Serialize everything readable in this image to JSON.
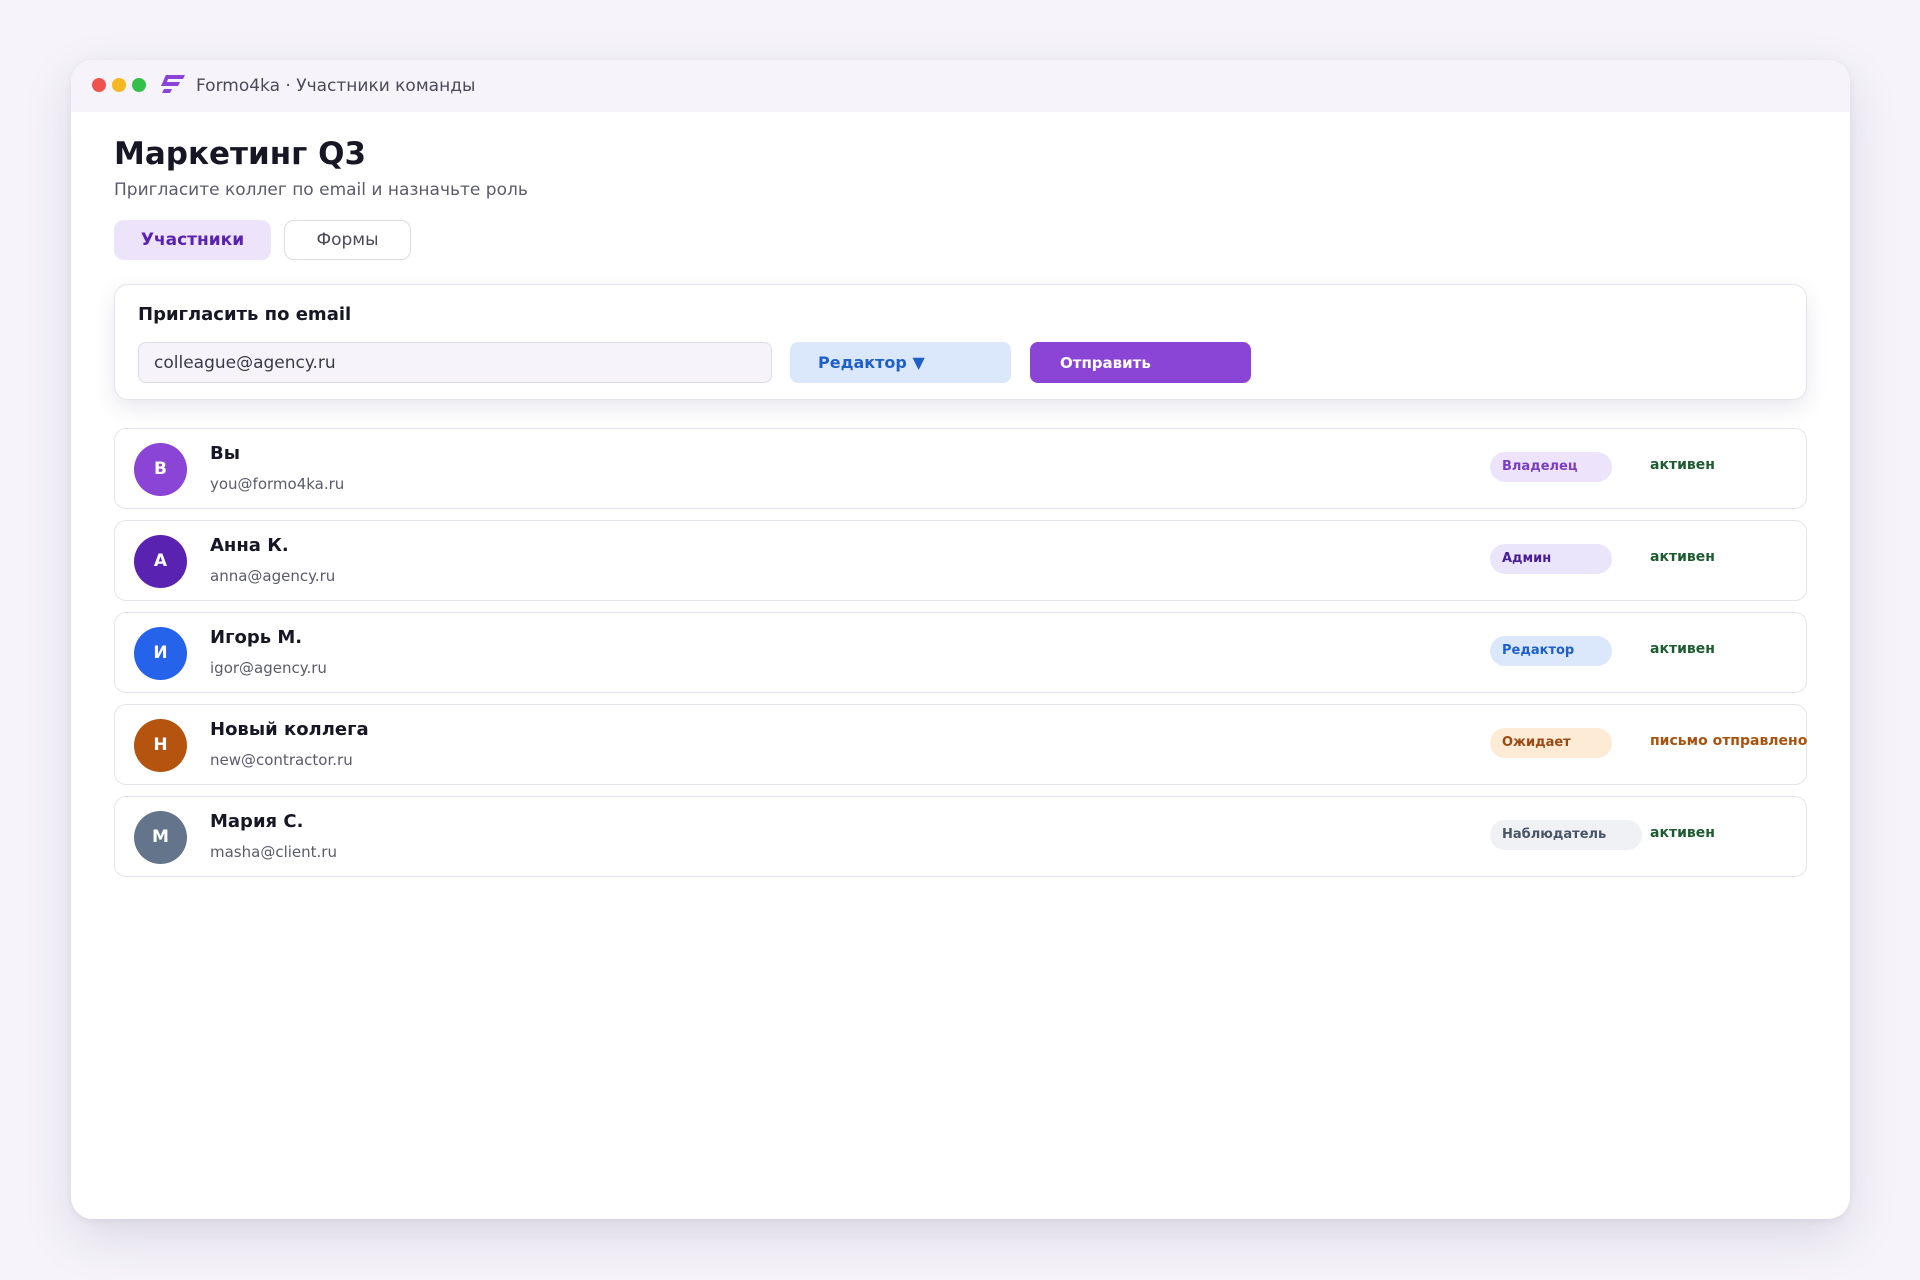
{
  "window": {
    "title": "Formo4ka · Участники команды"
  },
  "page": {
    "title": "Маркетинг Q3",
    "subtitle": "Пригласите коллег по email и назначьте роль"
  },
  "tabs": [
    {
      "label": "Участники",
      "active": true
    },
    {
      "label": "Формы",
      "active": false
    }
  ],
  "invite": {
    "title": "Пригласить по email",
    "email_value": "colleague@agency.ru",
    "role_label": "Редактор ▼",
    "send_label": "Отправить"
  },
  "members": [
    {
      "initial": "В",
      "name": "Вы",
      "email": "you@formo4ka.ru",
      "role": "Владелец",
      "status": "активен",
      "avatar_color": "#8a44d6",
      "role_bg": "#ede4fc",
      "role_color": "#7a3fc0",
      "status_color": "#1e5b30"
    },
    {
      "initial": "А",
      "name": "Анна К.",
      "email": "anna@agency.ru",
      "role": "Админ",
      "status": "активен",
      "avatar_color": "#5a22b0",
      "role_bg": "#ebe5fb",
      "role_color": "#4a1e98",
      "status_color": "#1e5b30"
    },
    {
      "initial": "И",
      "name": "Игорь М.",
      "email": "igor@agency.ru",
      "role": "Редактор",
      "status": "активен",
      "avatar_color": "#2563eb",
      "role_bg": "#dbe8fc",
      "role_color": "#1f5fc8",
      "status_color": "#1e5b30"
    },
    {
      "initial": "Н",
      "name": "Новый коллега",
      "email": "new@contractor.ru",
      "role": "Ожидает",
      "status": "письмо отправлено",
      "avatar_color": "#b5540f",
      "role_bg": "#fdebd5",
      "role_color": "#9a4a12",
      "status_color": "#a8520f"
    },
    {
      "initial": "М",
      "name": "Мария С.",
      "email": "masha@client.ru",
      "role": "Наблюдатель",
      "status": "активен",
      "avatar_color": "#64748b",
      "role_bg": "#eff1f5",
      "role_color": "#4a5568",
      "status_color": "#1e5b30"
    }
  ],
  "colors": {
    "accent": "#8a44d6",
    "accent_soft": "#ede4fc",
    "window_bg": "#ffffff",
    "page_bg": "#f6f4fa"
  }
}
